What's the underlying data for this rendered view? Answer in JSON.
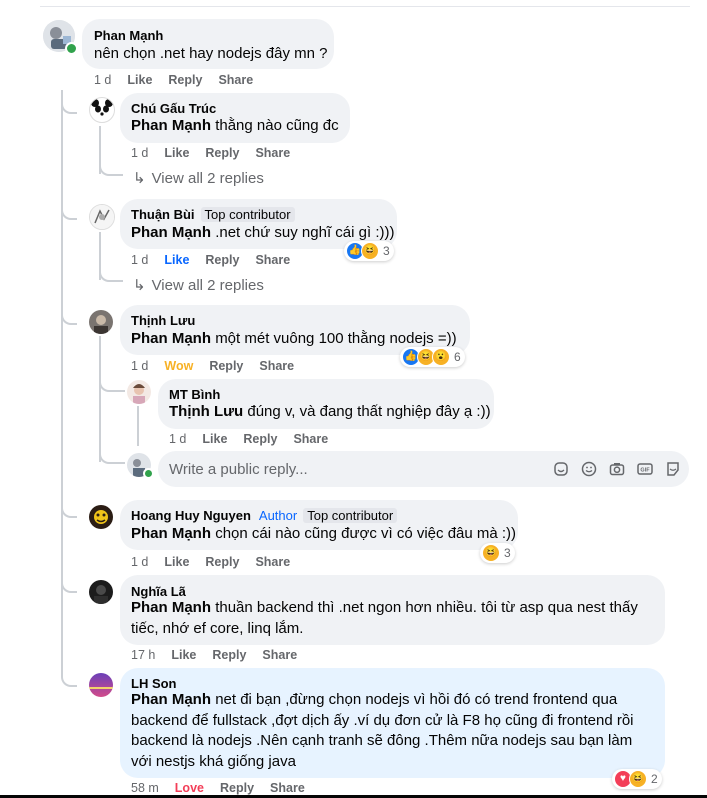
{
  "actions": {
    "like": "Like",
    "reply": "Reply",
    "share": "Share",
    "wow": "Wow",
    "love": "Love"
  },
  "view_replies": "View all 2 replies",
  "input": {
    "placeholder": "Write a public reply..."
  },
  "comments": [
    {
      "author": "Phan Mạnh",
      "text": "nên chọn .net hay nodejs đây mn ?",
      "time": "1 d"
    },
    {
      "author": "Chú Gấu Trúc",
      "mention": "Phan Mạnh",
      "text": "thằng nào cũng đc",
      "time": "1 d"
    },
    {
      "author": "Thuận Bùi",
      "badge": "Top contributor",
      "mention": "Phan Mạnh",
      "text": ".net chứ suy nghĩ cái gì :)))",
      "time": "1 d",
      "reactions": "3"
    },
    {
      "author": "Thịnh Lưu",
      "mention": "Phan Mạnh",
      "text": "một mét vuông 100 thằng nodejs =))",
      "time": "1 d",
      "reactions": "6"
    },
    {
      "author": "MT Bình",
      "mention": "Thịnh Lưu",
      "text": "đúng v, và đang thất nghiệp đây ạ :))",
      "time": "1 d"
    },
    {
      "author": "Hoang Huy Nguyen",
      "badge_author": "Author",
      "badge": "Top contributor",
      "mention": "Phan Mạnh",
      "text": "chọn cái nào cũng được vì có việc đâu mà :))",
      "time": "1 d",
      "reactions": "3"
    },
    {
      "author": "Nghĩa Lã",
      "mention": "Phan Mạnh",
      "text": "thuần backend thì .net ngon hơn nhiều. tôi từ asp qua nest thấy tiếc, nhớ ef core, linq lắm.",
      "time": "17 h"
    },
    {
      "author": "LH Son",
      "mention": "Phan Mạnh",
      "text": "net đi bạn ,đừng chọn nodejs vì hồi đó có trend frontend qua backend để fullstack ,đợt dịch ấy .ví dụ đơn cử là F8 họ cũng đi frontend rồi backend là nodejs .Nên cạnh tranh sẽ đông .Thêm nữa nodejs sau bạn làm với nestjs khá giống java",
      "time": "58 m",
      "reactions": "2"
    }
  ]
}
